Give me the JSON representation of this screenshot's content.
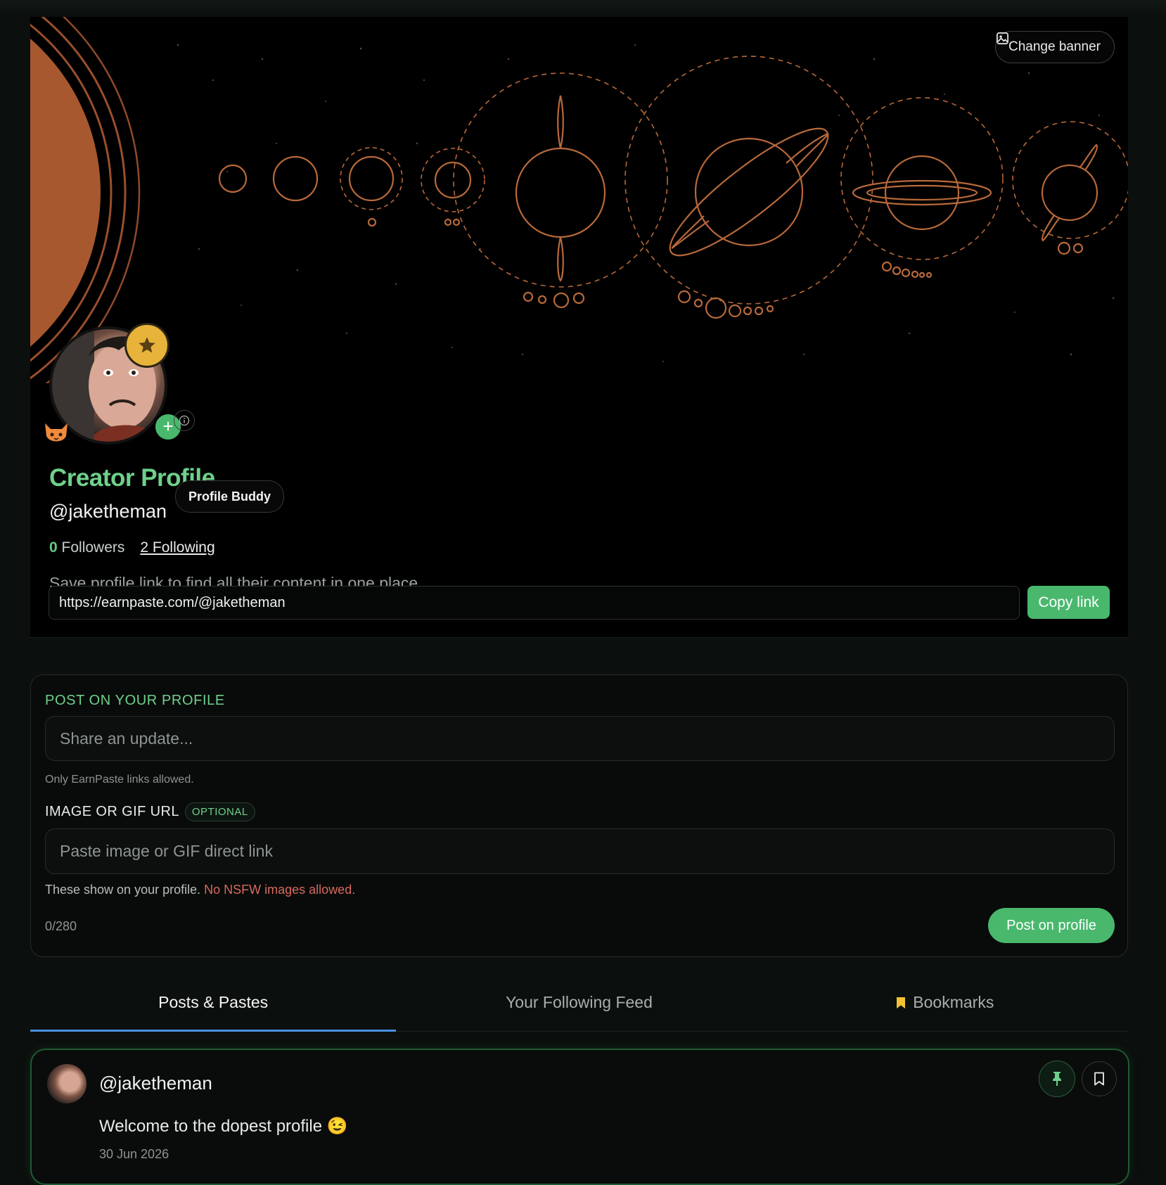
{
  "banner": {
    "change_label": "Change banner"
  },
  "profile": {
    "title": "Creator Profile",
    "handle": "@jaketheman",
    "buddy_label": "Profile Buddy",
    "followers_count": "0",
    "followers_label": "Followers",
    "following_count": "2",
    "following_label": "Following",
    "save_hint": "Save profile link to find all their content in one place",
    "link": "https://earnpaste.com/@jaketheman",
    "copy_label": "Copy link"
  },
  "composer": {
    "section_label": "POST ON YOUR PROFILE",
    "update_placeholder": "Share an update...",
    "only_hint": "Only EarnPaste links allowed.",
    "image_label": "IMAGE OR GIF URL",
    "optional_label": "OPTIONAL",
    "image_placeholder": "Paste image or GIF direct link",
    "show_hint": "These show on your profile.",
    "nsfw_warning": "No NSFW images allowed.",
    "counter": "0/280",
    "post_label": "Post on profile"
  },
  "tabs": [
    {
      "label": "Posts & Pastes",
      "active": true
    },
    {
      "label": "Your Following Feed",
      "active": false
    },
    {
      "label": "Bookmarks",
      "active": false,
      "icon": "bookmark-icon"
    }
  ],
  "post": {
    "handle": "@jaketheman",
    "text": "Welcome to the dopest profile 😉",
    "date": "30 Jun 2026"
  },
  "colors": {
    "accent": "#49b86d",
    "title": "#6fd08b",
    "tab_underline": "#4a8fe0",
    "warning": "#d66a5f",
    "banner_lines": "#b8693a"
  }
}
